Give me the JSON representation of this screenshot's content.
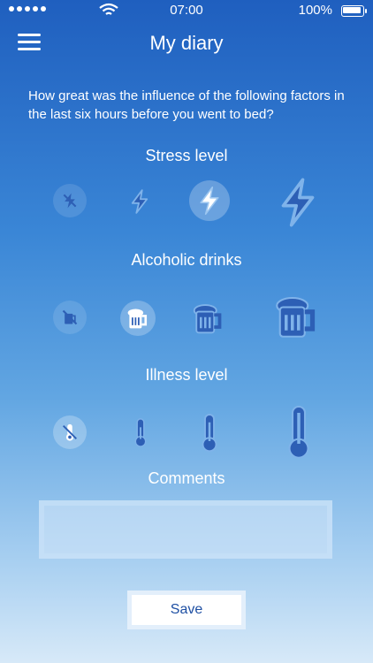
{
  "status": {
    "time": "07:00",
    "battery": "100%"
  },
  "header": {
    "title": "My diary"
  },
  "question": "How great was the influence of the following factors in the last six hours before you went to bed?",
  "stress": {
    "label": "Stress level",
    "options": [
      "none",
      "low",
      "medium",
      "high"
    ],
    "selected": "medium"
  },
  "alcohol": {
    "label": "Alcoholic drinks",
    "options": [
      "none",
      "low",
      "medium",
      "high"
    ],
    "selected": "low"
  },
  "illness": {
    "label": "Illness level",
    "options": [
      "none",
      "low",
      "medium",
      "high"
    ],
    "selected": "none"
  },
  "comments": {
    "label": "Comments",
    "value": ""
  },
  "actions": {
    "save_label": "Save"
  },
  "colors": {
    "icon_dark": "#2d5fb5",
    "icon_selected": "#ffffff"
  }
}
